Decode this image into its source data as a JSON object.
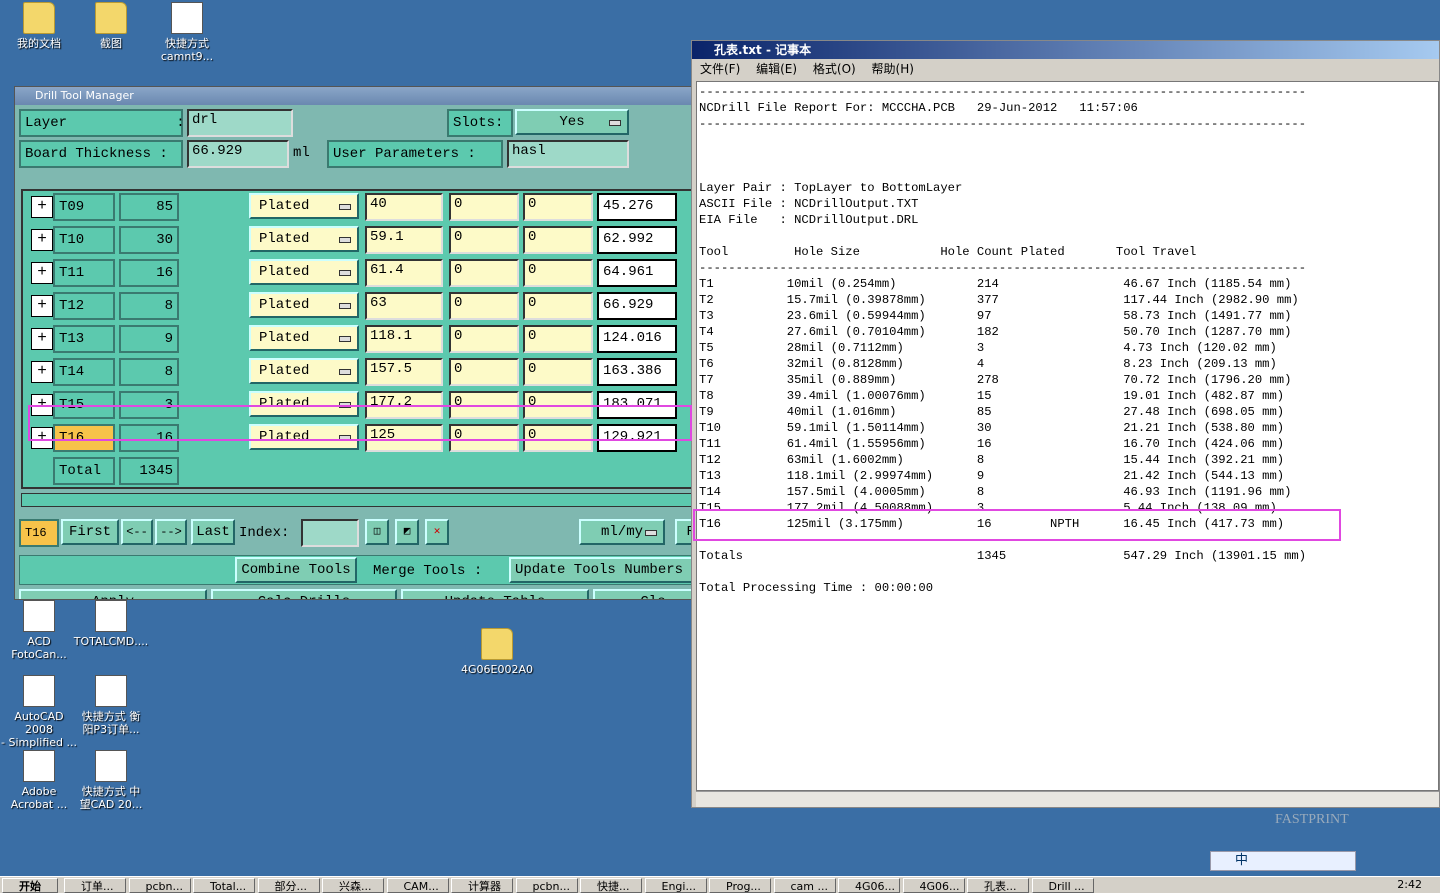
{
  "desktop": {
    "icons": [
      {
        "label": "我的文档",
        "x": 0,
        "y": 0
      },
      {
        "label": "截图",
        "x": 1,
        "y": 0
      },
      {
        "label": "快捷方式\ncamnt9...",
        "x": 2,
        "y": 0
      },
      {
        "label": "ACD\nFotoCan...",
        "x": 0,
        "y": 1
      },
      {
        "label": "TOTALCMD....",
        "x": 1,
        "y": 1
      },
      {
        "label": "AutoCAD 2008\n- Simplified ...",
        "x": 0,
        "y": 2
      },
      {
        "label": "快捷方式 衡\n阳P3订单...",
        "x": 1,
        "y": 2
      },
      {
        "label": "Adobe\nAcrobat ...",
        "x": 0,
        "y": 3
      },
      {
        "label": "快捷方式 中\n望CAD 20...",
        "x": 1,
        "y": 3
      }
    ],
    "folder_label": "4G06E002A0",
    "logo": "FASTPRINT"
  },
  "dtm": {
    "title": "Drill Tool Manager",
    "layer_label": "Layer             :",
    "layer_value": "drl",
    "slots_label": "Slots:",
    "slots_value": "Yes",
    "board_label": "Board Thickness :",
    "board_value": "66.929",
    "board_unit": "ml",
    "user_label": "User Parameters :",
    "user_value": "hasl",
    "rows": [
      {
        "tool": "T09",
        "count": "85",
        "type": "Plated",
        "size": "40",
        "a": "0",
        "b": "0",
        "fin": "45.276"
      },
      {
        "tool": "T10",
        "count": "30",
        "type": "Plated",
        "size": "59.1",
        "a": "0",
        "b": "0",
        "fin": "62.992"
      },
      {
        "tool": "T11",
        "count": "16",
        "type": "Plated",
        "size": "61.4",
        "a": "0",
        "b": "0",
        "fin": "64.961"
      },
      {
        "tool": "T12",
        "count": "8",
        "type": "Plated",
        "size": "63",
        "a": "0",
        "b": "0",
        "fin": "66.929"
      },
      {
        "tool": "T13",
        "count": "9",
        "type": "Plated",
        "size": "118.1",
        "a": "0",
        "b": "0",
        "fin": "124.016"
      },
      {
        "tool": "T14",
        "count": "8",
        "type": "Plated",
        "size": "157.5",
        "a": "0",
        "b": "0",
        "fin": "163.386"
      },
      {
        "tool": "T15",
        "count": "3",
        "type": "Plated",
        "size": "177.2",
        "a": "0",
        "b": "0",
        "fin": "183.071"
      },
      {
        "tool": "T16",
        "count": "16",
        "type": "Plated",
        "size": "125",
        "a": "0",
        "b": "0",
        "fin": "129.921"
      }
    ],
    "total_label": "Total",
    "total_value": "1345",
    "nav_current": "T16",
    "first": "First",
    "prev": "<--",
    "next": "-->",
    "last": "Last",
    "index_label": "Index:",
    "units": "ml/my",
    "re": "Re",
    "combine": "Combine Tools",
    "merge": "Merge Tools :",
    "update_numbers": "Update Tools Numbers",
    "apply": "Apply",
    "calc": "Calc Drills",
    "update_table": "Update Table",
    "close": "Clo"
  },
  "notepad": {
    "title": "孔表.txt - 记事本",
    "menu": [
      "文件(F)",
      "编辑(E)",
      "格式(O)",
      "帮助(H)"
    ],
    "lines": [
      "-----------------------------------------------------------------------------------",
      "NCDrill File Report For: MCCCHA.PCB   29-Jun-2012   11:57:06",
      "-----------------------------------------------------------------------------------",
      "",
      "",
      "",
      "Layer Pair : TopLayer to BottomLayer",
      "ASCII File : NCDrillOutput.TXT",
      "EIA File   : NCDrillOutput.DRL",
      "",
      "Tool         Hole Size           Hole Count Plated       Tool Travel",
      "-----------------------------------------------------------------------------------",
      "T1          10mil (0.254mm)           214                 46.67 Inch (1185.54 mm)",
      "T2          15.7mil (0.39878mm)       377                 117.44 Inch (2982.90 mm)",
      "T3          23.6mil (0.59944mm)       97                  58.73 Inch (1491.77 mm)",
      "T4          27.6mil (0.70104mm)       182                 50.70 Inch (1287.70 mm)",
      "T5          28mil (0.7112mm)          3                   4.73 Inch (120.02 mm)",
      "T6          32mil (0.8128mm)          4                   8.23 Inch (209.13 mm)",
      "T7          35mil (0.889mm)           278                 70.72 Inch (1796.20 mm)",
      "T8          39.4mil (1.00076mm)       15                  19.01 Inch (482.87 mm)",
      "T9          40mil (1.016mm)           85                  27.48 Inch (698.05 mm)",
      "T10         59.1mil (1.50114mm)       30                  21.21 Inch (538.80 mm)",
      "T11         61.4mil (1.55956mm)       16                  16.70 Inch (424.06 mm)",
      "T12         63mil (1.6002mm)          8                   15.44 Inch (392.21 mm)",
      "T13         118.1mil (2.99974mm)      9                   21.42 Inch (544.13 mm)",
      "T14         157.5mil (4.0005mm)       8                   46.93 Inch (1191.96 mm)",
      "T15         177.2mil (4.50088mm)      3                   5.44 Inch (138.09 mm)",
      "T16         125mil (3.175mm)          16        NPTH      16.45 Inch (417.73 mm)",
      "",
      "Totals                                1345                547.29 Inch (13901.15 mm)",
      "",
      "Total Processing Time : 00:00:00"
    ]
  },
  "taskbar": {
    "start": "开始",
    "tasks": [
      "订单...",
      "pcbn...",
      "Total...",
      "部分...",
      "兴森...",
      "CAM...",
      "计算器",
      "pcbn...",
      "快捷...",
      "Engi...",
      "Prog...",
      "cam ...",
      "4G06...",
      "4G06...",
      "孔表...",
      "Drill ..."
    ],
    "ime": "中",
    "clock": "2:42"
  }
}
